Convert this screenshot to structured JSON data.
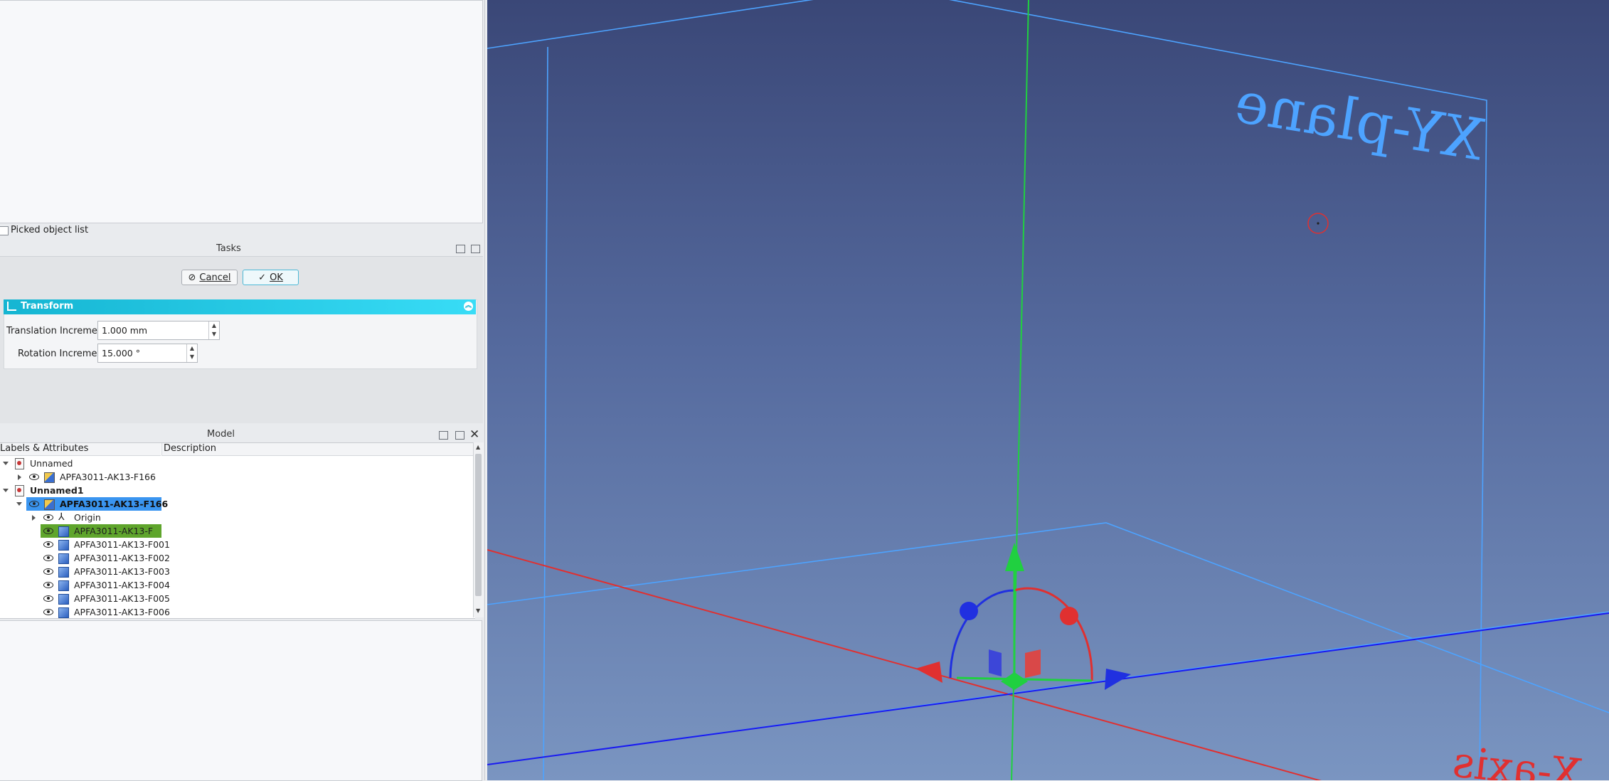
{
  "selection_panel": {
    "picked_list_label": "Picked object list"
  },
  "tasks_panel": {
    "title": "Tasks",
    "cancel_label": "Cancel",
    "ok_label": "OK",
    "transform": {
      "header": "Transform",
      "translation_label": "Translation Increment:",
      "translation_value": "1.000 mm",
      "rotation_label": "Rotation Increment:",
      "rotation_value": "15.000 °"
    }
  },
  "model_panel": {
    "title": "Model",
    "columns": [
      "Labels & Attributes",
      "Description"
    ],
    "tree": [
      {
        "label": "Unnamed"
      },
      {
        "label": "APFA3011-AK13-F166"
      },
      {
        "label": "Unnamed1"
      },
      {
        "label": "APFA3011-AK13-F166"
      },
      {
        "label": "Origin"
      },
      {
        "label": "APFA3011-AK13-F"
      },
      {
        "label": "APFA3011-AK13-F001"
      },
      {
        "label": "APFA3011-AK13-F002"
      },
      {
        "label": "APFA3011-AK13-F003"
      },
      {
        "label": "APFA3011-AK13-F004"
      },
      {
        "label": "APFA3011-AK13-F005"
      },
      {
        "label": "APFA3011-AK13-F006"
      }
    ]
  },
  "viewport": {
    "plane_label": "XY-plane",
    "axis_label": "X-axis",
    "colors": {
      "x_axis": "#e03030",
      "y_axis": "#1a1af0",
      "z_axis": "#20d040",
      "plane": "#4da3ff",
      "selected_row": "#3a95f0",
      "highlight_row": "#5fa52c"
    }
  }
}
